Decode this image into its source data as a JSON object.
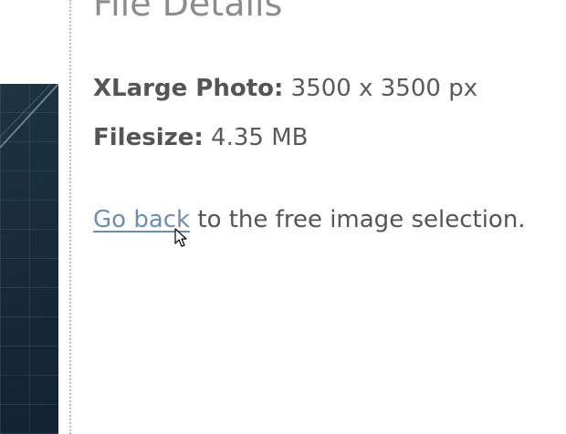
{
  "page": {
    "title": "File Details"
  },
  "details": {
    "photo_label": "XLarge Photo",
    "photo_value": "3500 x 3500 px",
    "filesize_label": "Filesize",
    "filesize_value": "4.35 MB",
    "separator": ":"
  },
  "navigation": {
    "back_link_label": "Go back",
    "back_suffix": " to the free image selection."
  },
  "colors": {
    "link": "#6a8fb3",
    "divider": "#e8a8b4",
    "title": "#8c8c8c",
    "body_text": "#5a5a5a"
  },
  "icons": {
    "pointer": "hand-pointer-cursor-icon"
  }
}
